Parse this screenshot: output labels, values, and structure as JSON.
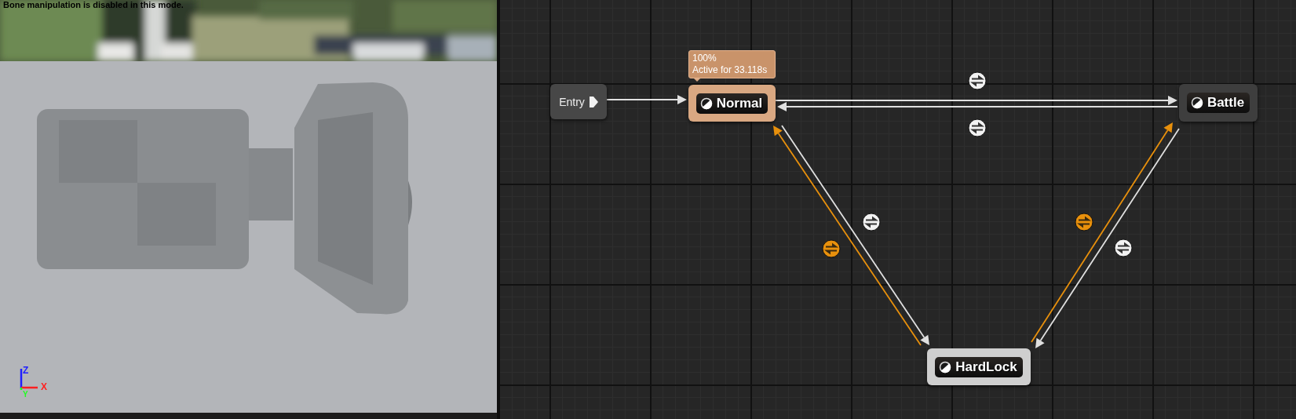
{
  "viewport": {
    "message": "Bone manipulation is disabled in this mode.",
    "axes": [
      {
        "label": "Z",
        "color": "#2020ff"
      },
      {
        "label": "X",
        "color": "#ff2020"
      },
      {
        "label": "Y",
        "color": "#20ff20"
      }
    ]
  },
  "graph": {
    "nodes": [
      {
        "kind": "entry",
        "label": "Entry"
      },
      {
        "kind": "state",
        "label": "Normal",
        "active": true,
        "highlighted": false,
        "tooltip": [
          "100%",
          "Active for 33.118s"
        ]
      },
      {
        "kind": "state",
        "label": "Battle",
        "active": false,
        "highlighted": false
      },
      {
        "kind": "state",
        "label": "HardLock",
        "active": false,
        "highlighted": true
      }
    ],
    "transitions": [
      {
        "kind": "entry",
        "active": false
      },
      {
        "kind": "rule",
        "active": false
      },
      {
        "kind": "rule",
        "active": false
      },
      {
        "kind": "rule",
        "active": false
      },
      {
        "kind": "rule",
        "active": true
      },
      {
        "kind": "rule",
        "active": true
      },
      {
        "kind": "rule",
        "active": false
      }
    ]
  }
}
